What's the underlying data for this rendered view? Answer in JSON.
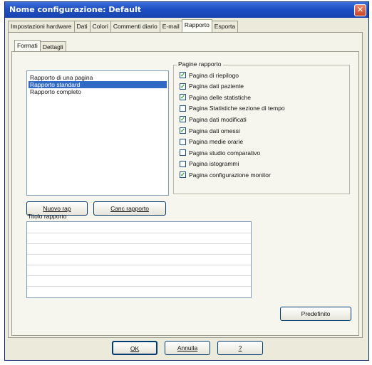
{
  "window": {
    "title": "Nome configurazione: Default",
    "close_glyph": "✕"
  },
  "tabs": [
    "Impostazioni hardware",
    "Dati",
    "Colori",
    "Commenti diario",
    "E-mail",
    "Rapporto",
    "Esporta"
  ],
  "subtabs": [
    "Formati",
    "Dettagli"
  ],
  "report_list": {
    "items": [
      "Rapporto di una pagina",
      "Rapporto standard",
      "Rapporto completo"
    ],
    "selected_index": 1
  },
  "pages_group": {
    "label": "Pagine rapporto",
    "items": [
      {
        "label": "Pagina di riepilogo",
        "checked": true
      },
      {
        "label": "Pagina dati paziente",
        "checked": true
      },
      {
        "label": "Pagina delle statistiche",
        "checked": true
      },
      {
        "label": "Pagina Statistiche sezione di tempo",
        "checked": false
      },
      {
        "label": "Pagina dati modificati",
        "checked": true
      },
      {
        "label": "Pagina dati omessi",
        "checked": true
      },
      {
        "label": "Pagina medie orarie",
        "checked": false
      },
      {
        "label": "Pagina studio comparativo",
        "checked": false
      },
      {
        "label": "Pagina istogrammi",
        "checked": false
      },
      {
        "label": "Pagina configurazione monitor",
        "checked": true
      }
    ]
  },
  "buttons": {
    "new_report": "Nuovo rap",
    "delete_report": "Canc rapporto",
    "default": "Predefinito",
    "ok": "OK",
    "cancel": "Annulla",
    "help": "?"
  },
  "report_title": {
    "label": "Titolo rapporto",
    "lines": 7
  }
}
